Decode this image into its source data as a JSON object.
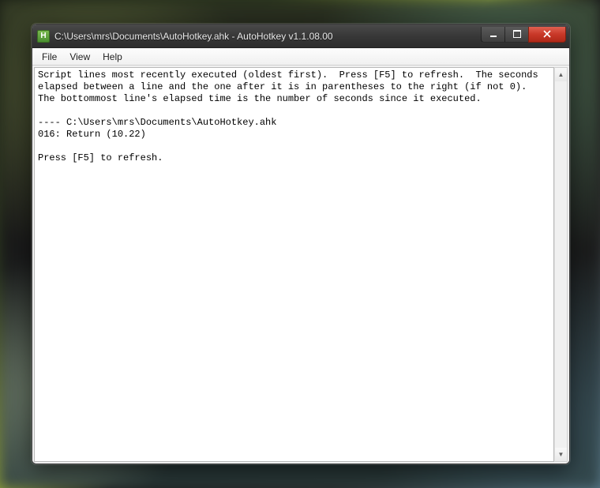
{
  "window": {
    "title": "C:\\Users\\mrs\\Documents\\AutoHotkey.ahk - AutoHotkey v1.1.08.00",
    "icon_letter": "H"
  },
  "menubar": {
    "items": [
      {
        "label": "File"
      },
      {
        "label": "View"
      },
      {
        "label": "Help"
      }
    ]
  },
  "content": {
    "text": "Script lines most recently executed (oldest first).  Press [F5] to refresh.  The seconds elapsed between a line and the one after it is in parentheses to the right (if not 0).  The bottommost line's elapsed time is the number of seconds since it executed.\n\n---- C:\\Users\\mrs\\Documents\\AutoHotkey.ahk\n016: Return (10.22)\n\nPress [F5] to refresh."
  }
}
